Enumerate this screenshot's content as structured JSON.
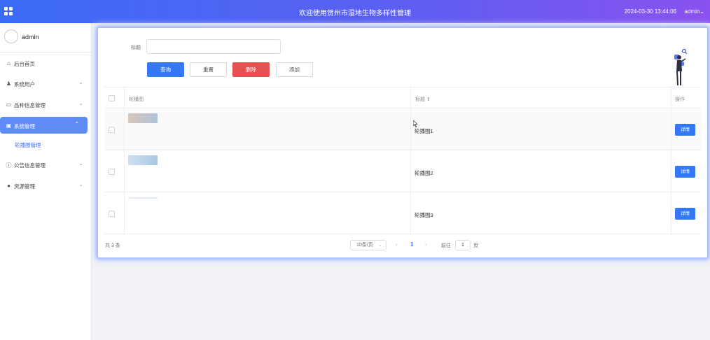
{
  "header": {
    "title": "欢迎使用贺州市湿地生物多样性管理",
    "datetime": "2024-03-30 13:44:06",
    "user": "admin",
    "user_caret": "⌄",
    "accent_color": "#3b6cf6"
  },
  "sidebar": {
    "profile_name": "admin",
    "items": [
      {
        "label": "后台首页",
        "icon": "home-icon",
        "glyph": "⌂",
        "chevron": ""
      },
      {
        "label": "系统用户",
        "icon": "user-icon",
        "glyph": "♟",
        "chevron": "⌄"
      },
      {
        "label": "品种信息管理",
        "icon": "folder-icon",
        "glyph": "▭",
        "chevron": "⌄"
      },
      {
        "label": "系统管理",
        "icon": "image-icon",
        "glyph": "▣",
        "chevron": "⌃"
      },
      {
        "label": "公告信息管理",
        "icon": "info-icon",
        "glyph": "ⓘ",
        "chevron": "⌄"
      },
      {
        "label": "资源管理",
        "icon": "location-icon",
        "glyph": "●",
        "chevron": "⌄"
      }
    ],
    "active_submenu": "轮播图管理"
  },
  "search": {
    "label": "标题",
    "value": ""
  },
  "toolbar": {
    "query": "查询",
    "reset": "重置",
    "delete": "删除",
    "add": "添加"
  },
  "table": {
    "columns": [
      "轮播图",
      "标题 ⇕",
      "操作"
    ],
    "rows": [
      {
        "title": "轮播图1",
        "action": "详情",
        "thumb_colors": [
          "#d8c7b6",
          "#b0c2dc"
        ]
      },
      {
        "title": "轮播图2",
        "action": "详情",
        "thumb_colors": [
          "#cfe0ef",
          "#a9c8e4"
        ]
      },
      {
        "title": "轮播图3",
        "action": "详情",
        "thumb_colors": [
          "#e8edf3",
          "#dde6ef"
        ]
      }
    ]
  },
  "pagination": {
    "total": "共 3 条",
    "page_size": "10条/页",
    "current_page": "1",
    "goto_label": "前往",
    "goto_value": "1",
    "goto_suffix": "页"
  }
}
